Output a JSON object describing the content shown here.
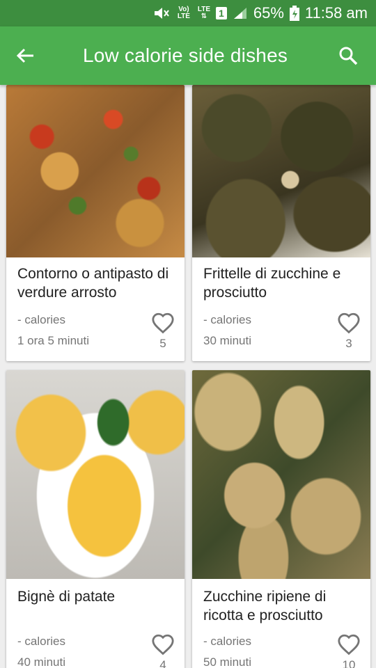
{
  "status_bar": {
    "volte": "Vo) LTE",
    "network": "LTE",
    "sim": "1",
    "battery": "65%",
    "time": "11:58 am"
  },
  "app_bar": {
    "title": "Low calorie side dishes",
    "back_icon": "arrow-back-icon",
    "search_icon": "search-icon"
  },
  "recipes": [
    {
      "name": "Contorno o antipasto di verdure arrosto",
      "calories": "- calories",
      "time": "1 ora 5 minuti",
      "likes": "5"
    },
    {
      "name": "Frittelle di zucchine e prosciutto",
      "calories": "- calories",
      "time": "30 minuti",
      "likes": "3"
    },
    {
      "name": "Bignè di patate",
      "calories": "- calories",
      "time": "40 minuti",
      "likes": "4"
    },
    {
      "name": "Zucchine ripiene di ricotta e prosciutto",
      "calories": "- calories",
      "time": "50 minuti",
      "likes": "10"
    }
  ],
  "colors": {
    "status_bar": "#3d8e3f",
    "app_bar": "#4caf50",
    "background": "#eeeeee"
  }
}
